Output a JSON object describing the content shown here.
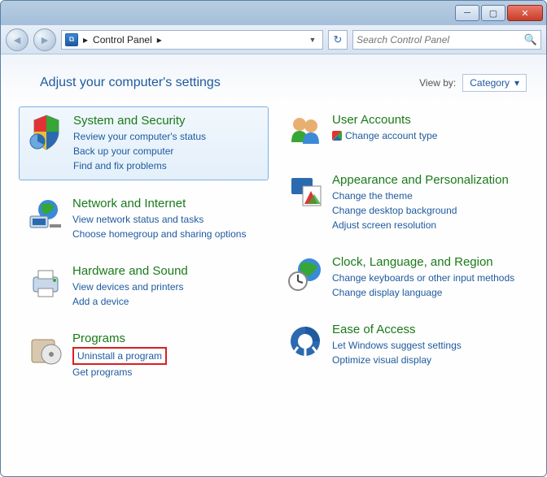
{
  "breadcrumb": "Control Panel",
  "search_placeholder": "Search Control Panel",
  "page_title": "Adjust your computer's settings",
  "viewby_label": "View by:",
  "viewby_value": "Category",
  "left": [
    {
      "title": "System and Security",
      "links": [
        "Review your computer's status",
        "Back up your computer",
        "Find and fix problems"
      ]
    },
    {
      "title": "Network and Internet",
      "links": [
        "View network status and tasks",
        "Choose homegroup and sharing options"
      ]
    },
    {
      "title": "Hardware and Sound",
      "links": [
        "View devices and printers",
        "Add a device"
      ]
    },
    {
      "title": "Programs",
      "links": [
        "Uninstall a program",
        "Get programs"
      ]
    }
  ],
  "right": [
    {
      "title": "User Accounts",
      "links": [
        "Change account type"
      ]
    },
    {
      "title": "Appearance and Personalization",
      "links": [
        "Change the theme",
        "Change desktop background",
        "Adjust screen resolution"
      ]
    },
    {
      "title": "Clock, Language, and Region",
      "links": [
        "Change keyboards or other input methods",
        "Change display language"
      ]
    },
    {
      "title": "Ease of Access",
      "links": [
        "Let Windows suggest settings",
        "Optimize visual display"
      ]
    }
  ]
}
